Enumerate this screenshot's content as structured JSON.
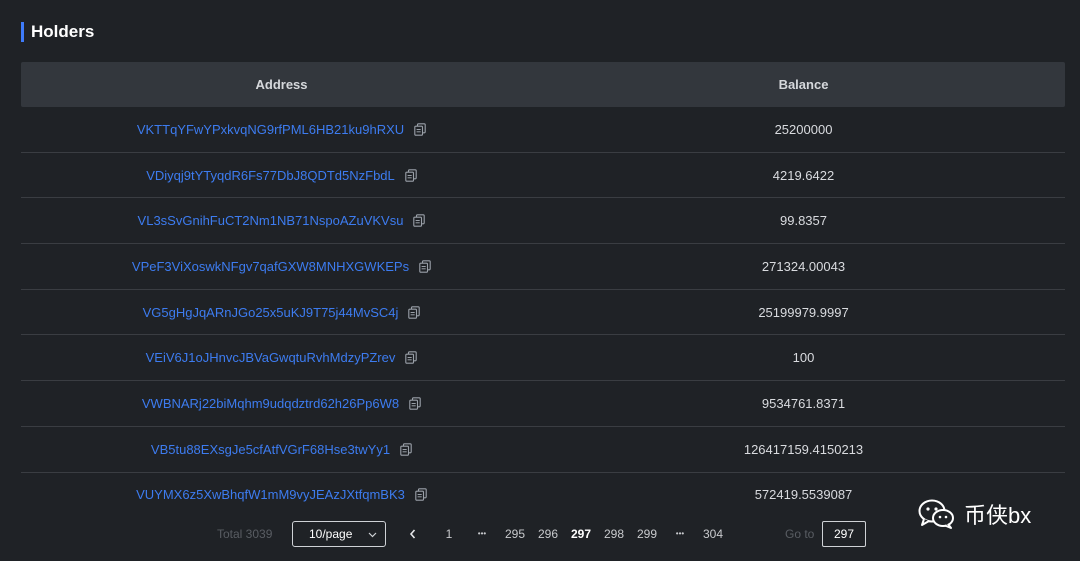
{
  "section": {
    "title": "Holders"
  },
  "table": {
    "columns": {
      "address": "Address",
      "balance": "Balance"
    },
    "rows": [
      {
        "address": "VKTTqYFwYPxkvqNG9rfPML6HB21ku9hRXU",
        "balance": "25200000"
      },
      {
        "address": "VDiyqj9tYTyqdR6Fs77DbJ8QDTd5NzFbdL",
        "balance": "4219.6422"
      },
      {
        "address": "VL3sSvGnihFuCT2Nm1NB71NspoAZuVKVsu",
        "balance": "99.8357"
      },
      {
        "address": "VPeF3ViXoswkNFgv7qafGXW8MNHXGWKEPs",
        "balance": "271324.00043"
      },
      {
        "address": "VG5gHgJqARnJGo25x5uKJ9T75j44MvSC4j",
        "balance": "25199979.9997"
      },
      {
        "address": "VEiV6J1oJHnvcJBVaGwqtuRvhMdzyPZrev",
        "balance": "100"
      },
      {
        "address": "VWBNARj22biMqhm9udqdztrd62h26Pp6W8",
        "balance": "9534761.8371"
      },
      {
        "address": "VB5tu88EXsgJe5cfAtfVGrF68Hse3twYy1",
        "balance": "126417159.4150213"
      },
      {
        "address": "VUYMX6z5XwBhqfW1mM9vyJEAzJXtfqmBK3",
        "balance": "572419.5539087"
      }
    ]
  },
  "pagination": {
    "total_text": "Total 3039",
    "page_size": "10/page",
    "prev": "<",
    "pages": [
      "1",
      "•••",
      "295",
      "296",
      "297",
      "298",
      "299",
      "•••",
      "304"
    ],
    "current": "297",
    "goto_label": "Go to",
    "goto_value": "297"
  },
  "watermark": {
    "text": "币侠bx"
  },
  "icons": {
    "copy": "copy-icon",
    "chevron": "chevron-down-icon",
    "prev": "chevron-left-icon",
    "wechat": "wechat-icon"
  },
  "colors": {
    "accent": "#3e7bfa",
    "link": "#3d7cf0",
    "background": "#1f2226",
    "header": "#33373d"
  }
}
